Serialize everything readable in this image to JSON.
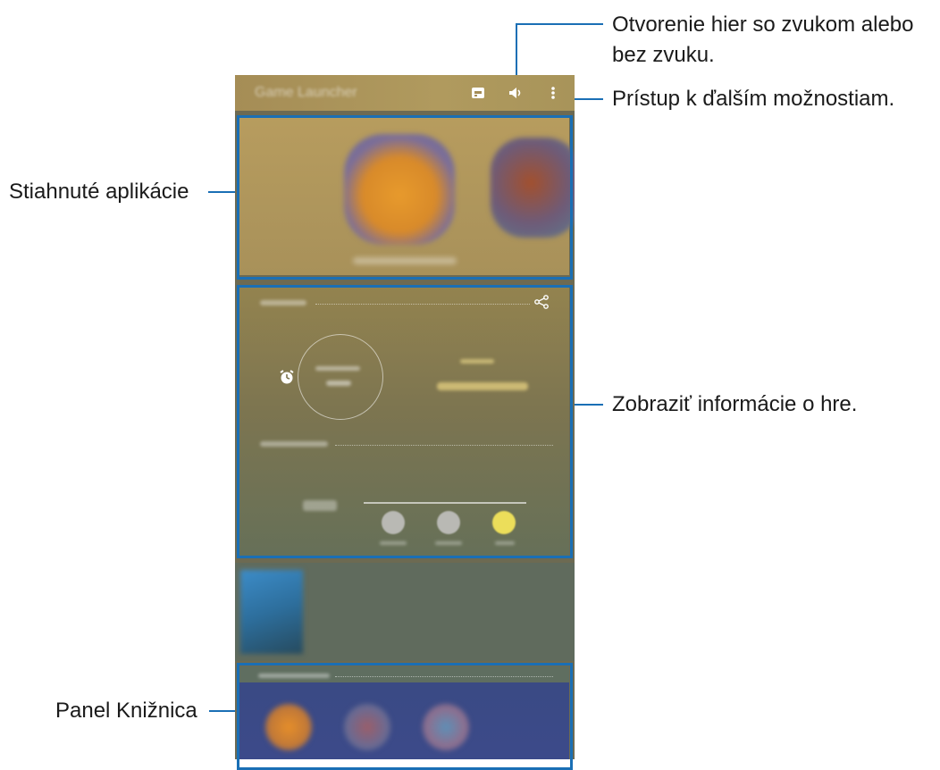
{
  "topbar": {
    "title": "Game Launcher",
    "icons": [
      "game-icon",
      "sound-icon",
      "more-options-icon"
    ]
  },
  "callouts": {
    "sound": [
      "Otvorenie hier so zvukom alebo",
      "bez zvuku."
    ],
    "more_options": "Prístup k ďalším možnostiam.",
    "downloaded_apps": "Stiahnuté aplikácie",
    "game_info": "Zobraziť informácie o hre.",
    "library_panel": "Panel Knižnica"
  },
  "colors": {
    "accent_line": "#1a6fb5",
    "topbar": "#a58d56",
    "downloaded_bg": "#b09a5e",
    "info_bg": "#7d7550",
    "library_bg": "#5f6e60"
  }
}
